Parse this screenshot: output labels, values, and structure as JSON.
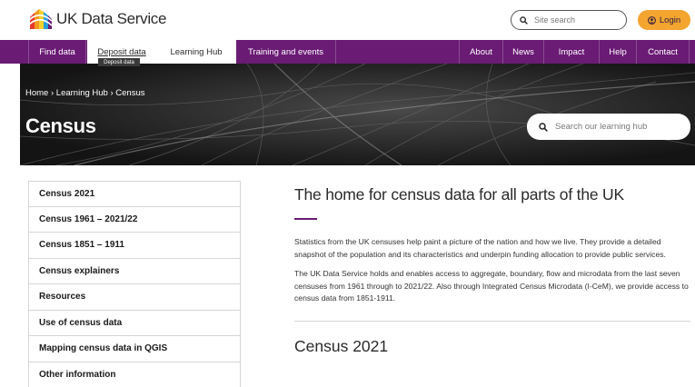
{
  "header": {
    "logo_text": "UK Data Service",
    "search_placeholder": "Site search",
    "login_label": "Login"
  },
  "nav": {
    "items": [
      {
        "label": "Find data"
      },
      {
        "label": "Deposit data"
      },
      {
        "label": "Learning Hub"
      },
      {
        "label": "Training and events"
      },
      {
        "label": "About"
      },
      {
        "label": "News"
      },
      {
        "label": "Impact"
      },
      {
        "label": "Help"
      },
      {
        "label": "Contact"
      }
    ],
    "tooltip": "Deposit data"
  },
  "hero": {
    "breadcrumb": "Home › Learning Hub › Census",
    "title": "Census",
    "search_placeholder": "Search our learning hub"
  },
  "sidebar": {
    "items": [
      {
        "label": "Census 2021"
      },
      {
        "label": "Census 1961 – 2021/22"
      },
      {
        "label": "Census 1851 – 1911"
      },
      {
        "label": "Census explainers"
      },
      {
        "label": "Resources"
      },
      {
        "label": "Use of census data"
      },
      {
        "label": "Mapping census data in QGIS"
      },
      {
        "label": "Other information"
      }
    ]
  },
  "main": {
    "heading": "The home for census data for all parts of the UK",
    "para1": "Statistics from the UK censuses help paint a picture of the nation and how we live. They provide a detailed snapshot of the population and its characteristics and underpin funding allocation to provide public services.",
    "para2": "The UK Data Service holds and enables access to aggregate, boundary, flow and microdata from the last seven censuses from 1961 through to 2021/22. Also through Integrated Census Microdata (I-CeM), we provide access to census data from 1851-1911.",
    "subheading": "Census 2021"
  },
  "colors": {
    "brand_purple": "#6a1b74",
    "login_orange": "#f3a530"
  },
  "icons": {
    "logo": "ukds-logo-icon",
    "search": "search-icon",
    "login": "user-icon"
  }
}
